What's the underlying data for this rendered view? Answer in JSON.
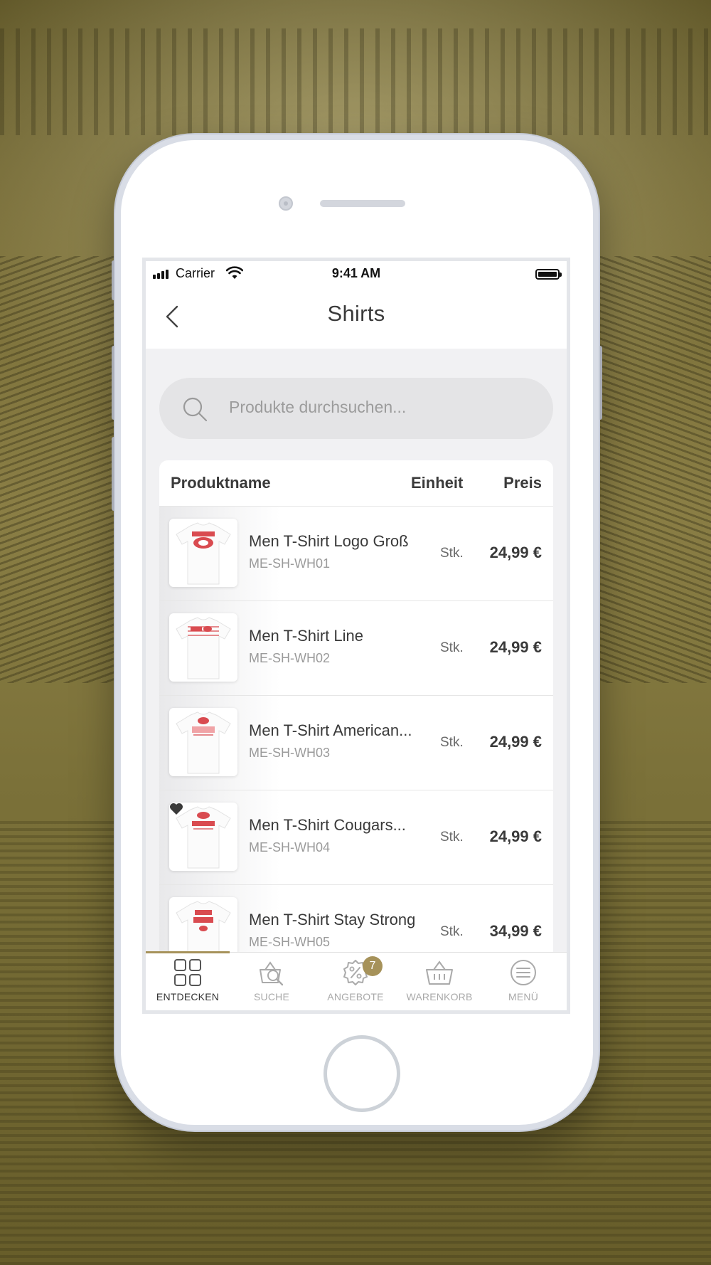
{
  "status_bar": {
    "carrier": "Carrier",
    "time": "9:41 AM"
  },
  "nav": {
    "title": "Shirts",
    "back_icon": "chevron-left-icon"
  },
  "search": {
    "placeholder": "Produkte durchsuchen..."
  },
  "table": {
    "headers": {
      "name": "Produktname",
      "unit": "Einheit",
      "price": "Preis"
    },
    "rows": [
      {
        "name": "Men T-Shirt Logo Groß",
        "sku": "ME-SH-WH01",
        "unit": "Stk.",
        "price": "24,99 €",
        "print": "COUGARS",
        "favorite": false
      },
      {
        "name": "Men T-Shirt Line",
        "sku": "ME-SH-WH02",
        "unit": "Stk.",
        "price": "24,99 €",
        "print": "COUGARS",
        "favorite": false
      },
      {
        "name": "Men T-Shirt American...",
        "sku": "ME-SH-WH03",
        "unit": "Stk.",
        "price": "24,99 €",
        "print": "COUGARS",
        "favorite": false
      },
      {
        "name": "Men T-Shirt Cougars...",
        "sku": "ME-SH-WH04",
        "unit": "Stk.",
        "price": "24,99 €",
        "print": "COUGARS",
        "favorite": true
      },
      {
        "name": "Men T-Shirt Stay Strong",
        "sku": "ME-SH-WH05",
        "unit": "Stk.",
        "price": "34,99 €",
        "print": "STAY STRONG",
        "favorite": false
      }
    ]
  },
  "tabbar": {
    "tabs": [
      {
        "label": "ENTDECKEN",
        "icon": "grid-icon",
        "active": true
      },
      {
        "label": "SUCHE",
        "icon": "basket-search-icon",
        "active": false
      },
      {
        "label": "ANGEBOTE",
        "icon": "percent-badge-icon",
        "active": false,
        "badge": "7"
      },
      {
        "label": "WARENKORB",
        "icon": "basket-icon",
        "active": false
      },
      {
        "label": "MENÜ",
        "icon": "menu-icon",
        "active": false
      }
    ]
  },
  "colors": {
    "accent": "#a6925a",
    "backdrop": "#7a6f39",
    "text": "#3a3a3a",
    "muted": "#9a9a9a",
    "print_red": "#d94b50"
  }
}
